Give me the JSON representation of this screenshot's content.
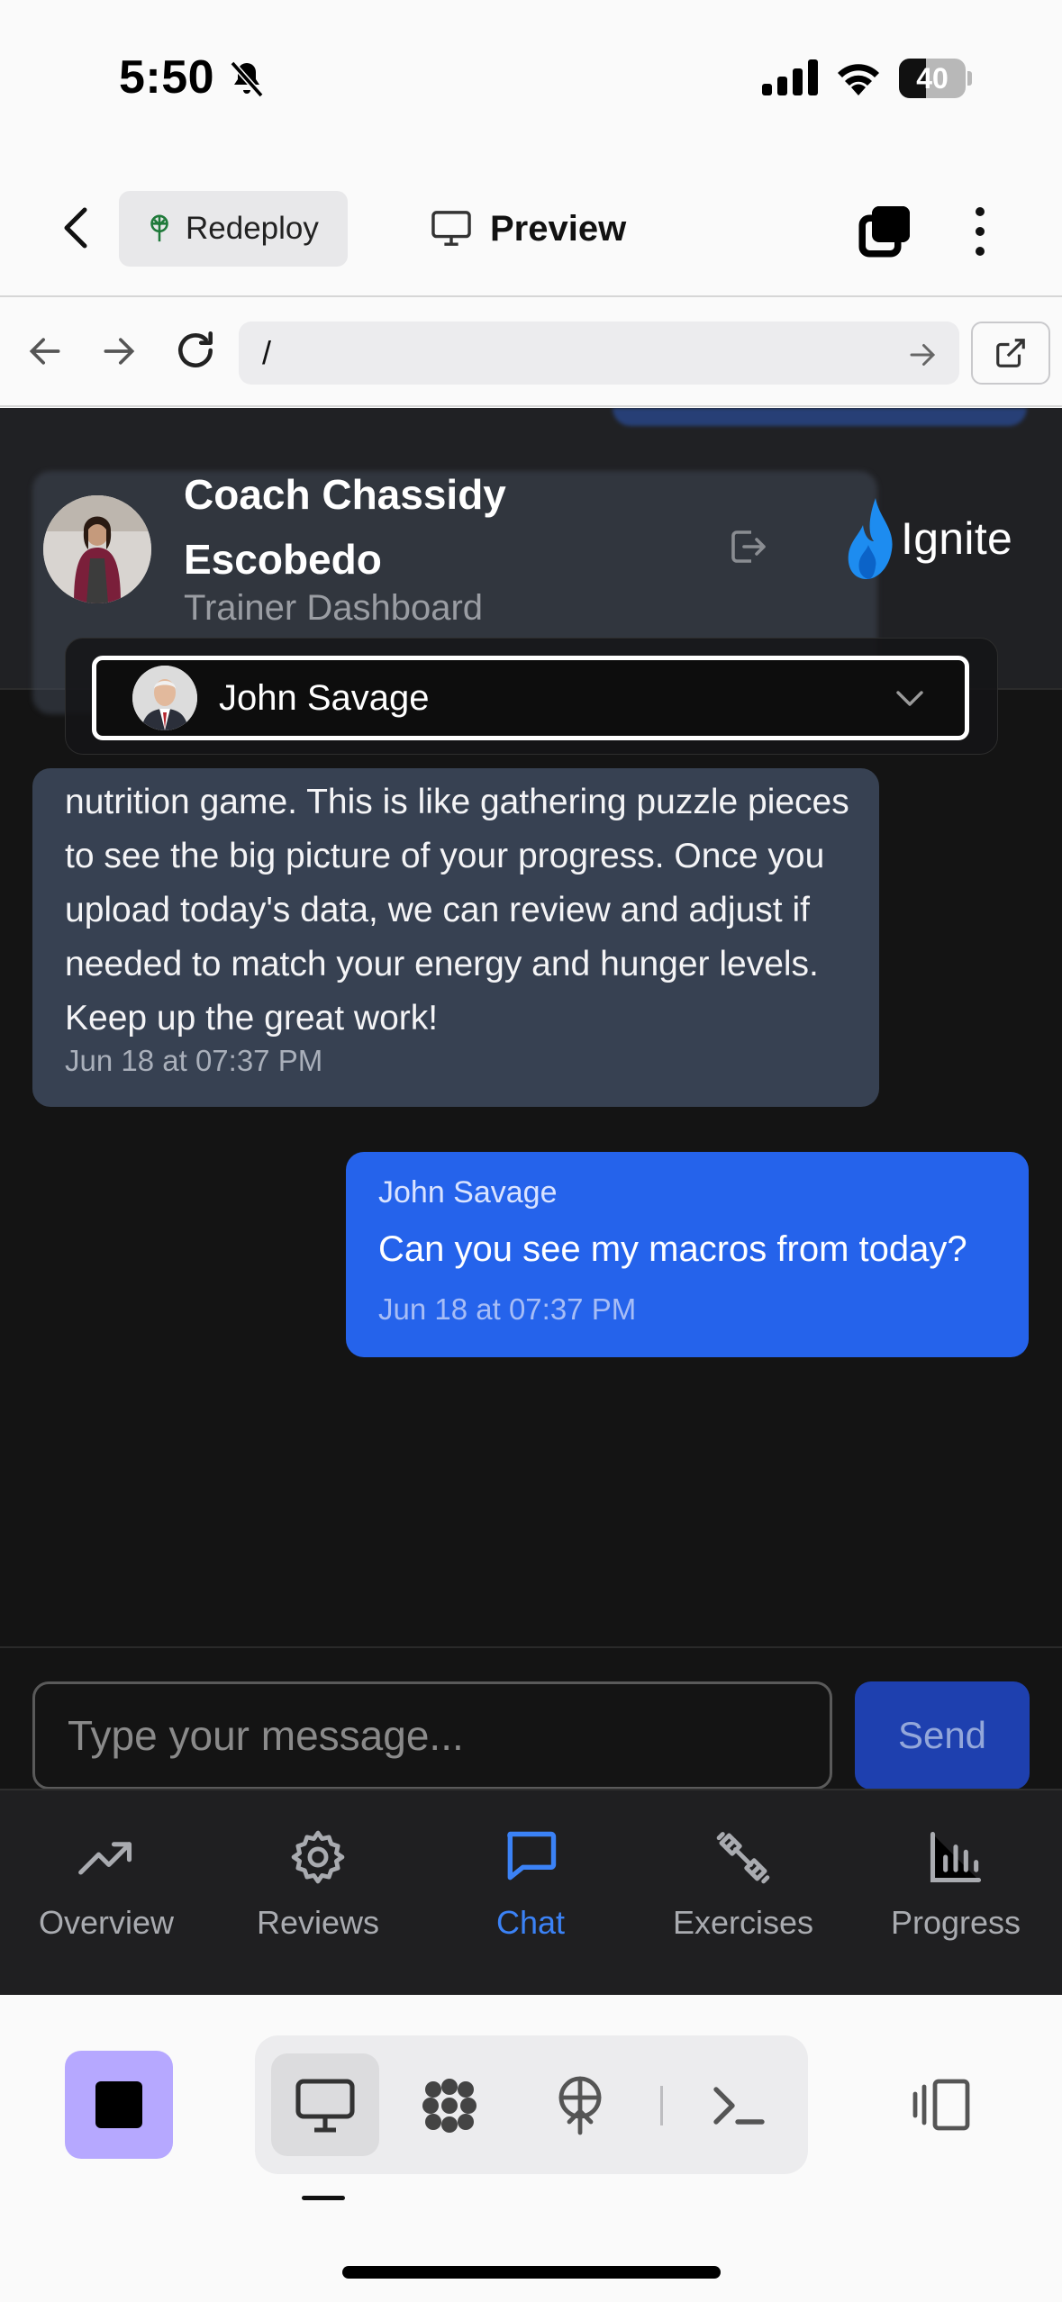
{
  "status_bar": {
    "time": "5:50",
    "battery": "40",
    "battery_level": 0.4
  },
  "toolbar": {
    "redeploy_label": "Redeploy",
    "preview_label": "Preview"
  },
  "browser": {
    "url": "/"
  },
  "header": {
    "coach_name": "Coach Chassidy Escobedo",
    "subtitle": "Trainer Dashboard",
    "logo_text": "Ignite"
  },
  "client_select": {
    "selected": "John Savage"
  },
  "messages": [
    {
      "direction": "incoming",
      "text": "nutrition game. This is like gathering puzzle pieces to see the big picture of your progress. Once you upload today's data, we can review and adjust if needed to match your energy and hunger levels. Keep up the great work!",
      "timestamp": "Jun 18 at 07:37 PM"
    },
    {
      "direction": "outgoing",
      "sender": "John Savage",
      "text": "Can you see my macros from today?",
      "timestamp": "Jun 18 at 07:37 PM"
    }
  ],
  "composer": {
    "placeholder": "Type your message...",
    "send_label": "Send"
  },
  "tabs": [
    {
      "label": "Overview",
      "icon": "trend-up-icon"
    },
    {
      "label": "Reviews",
      "icon": "gear-icon"
    },
    {
      "label": "Chat",
      "icon": "chat-bubble-icon",
      "active": true
    },
    {
      "label": "Exercises",
      "icon": "dumbbell-icon"
    },
    {
      "label": "Progress",
      "icon": "bar-chart-icon"
    }
  ],
  "colors": {
    "accent": "#2563eb",
    "app_bg": "#141414",
    "incoming_bubble": "#374152",
    "stop_button": "#b6a8ff"
  }
}
